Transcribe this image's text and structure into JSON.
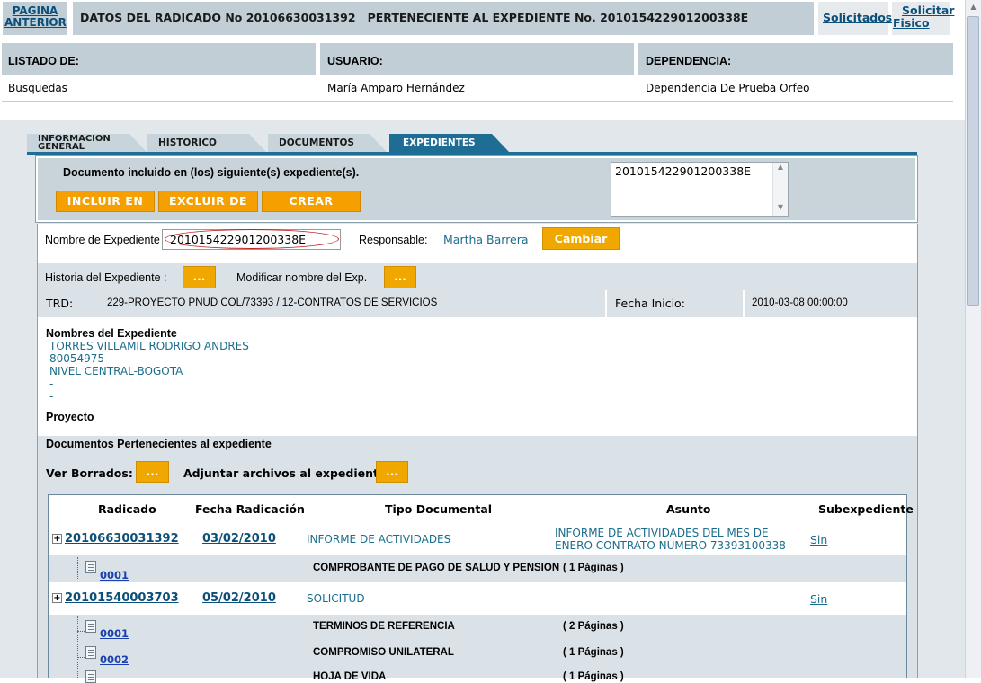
{
  "top": {
    "back_line1": "PAGINA",
    "back_line2": "ANTERIOR",
    "title": "DATOS DEL RADICADO No 20106630031392   PERTENECIENTE AL EXPEDIENTE No. 201015422901200338E",
    "solicitados": "Solicitados",
    "solicitar_line1": "Solicitar",
    "solicitar_line2": "Fisico"
  },
  "info": {
    "listado_label": "LISTADO DE:",
    "listado_value": "Busquedas",
    "usuario_label": "USUARIO:",
    "usuario_value": "María Amparo Hernández",
    "dependencia_label": "DEPENDENCIA:",
    "dependencia_value": "Dependencia De Prueba Orfeo"
  },
  "tabs": [
    {
      "label_line1": "INFORMACION",
      "label_line2": "GENERAL"
    },
    {
      "label": "HISTORICO"
    },
    {
      "label": "DOCUMENTOS"
    },
    {
      "label": "EXPEDIENTES"
    }
  ],
  "included": {
    "text": "Documento incluido en (los) siguiente(s) expediente(s).",
    "incluir": "INCLUIR EN",
    "excluir": "EXCLUIR DE",
    "crear": "CREAR",
    "list_value": "201015422901200338E"
  },
  "expediente": {
    "nombre_label": "Nombre de Expediente :",
    "nombre_value": "201015422901200338E",
    "responsable_label": "Responsable:",
    "responsable_value": "Martha Barrera",
    "cambiar": "Cambiar",
    "historia_label": "Historia del Expediente :",
    "modificar_label": "Modificar nombre del Exp.",
    "dots": "...",
    "trd_label": "TRD:",
    "trd_value": "229-PROYECTO PNUD COL/73393 / 12-CONTRATOS DE SERVICIOS",
    "fecha_label": "Fecha Inicio:",
    "fecha_value": "2010-03-08 00:00:00",
    "nombres_title": "Nombres del Expediente",
    "nombres": [
      "TORRES VILLAMIL RODRIGO ANDRES",
      "80054975",
      "NIVEL CENTRAL-BOGOTA",
      "-",
      "-"
    ],
    "proyecto_label": "Proyecto",
    "docs_title": "Documentos Pertenecientes al expediente",
    "ver_borrados": "Ver Borrados:",
    "adjuntar": "Adjuntar archivos al expediente"
  },
  "table": {
    "headers": [
      "Radicado",
      "Fecha Radicación",
      "Tipo Documental",
      "Asunto",
      "Subexpediente"
    ],
    "rows": [
      {
        "radicado": "20106630031392",
        "fecha": "03/02/2010",
        "tipo": "INFORME DE ACTIVIDADES",
        "asunto_line1": "INFORME DE ACTIVIDADES DEL MES DE",
        "asunto_line2": "ENERO CONTRATO NUMERO 73393100338",
        "sub": "Sin"
      },
      {
        "annex": "0001",
        "desc": "COMPROBANTE DE PAGO DE SALUD Y PENSION",
        "pages": "( 1 Páginas )"
      },
      {
        "radicado": "20101540003703",
        "fecha": "05/02/2010",
        "tipo": "SOLICITUD",
        "asunto_line1": "",
        "asunto_line2": "",
        "sub": "Sin"
      },
      {
        "annex": "0001",
        "desc": "TERMINOS DE REFERENCIA",
        "pages": "( 2 Páginas )"
      },
      {
        "annex": "0002",
        "desc": "COMPROMISO UNILATERAL",
        "pages": "( 1 Páginas )"
      },
      {
        "annex": "",
        "desc": "HOJA DE VIDA",
        "pages": "( 1 Páginas )"
      }
    ]
  },
  "colors": {
    "orange": "#f5a000",
    "teal": "#1b6d8c",
    "header_grey": "#c2ced6",
    "active_tab": "#1e6d95"
  }
}
